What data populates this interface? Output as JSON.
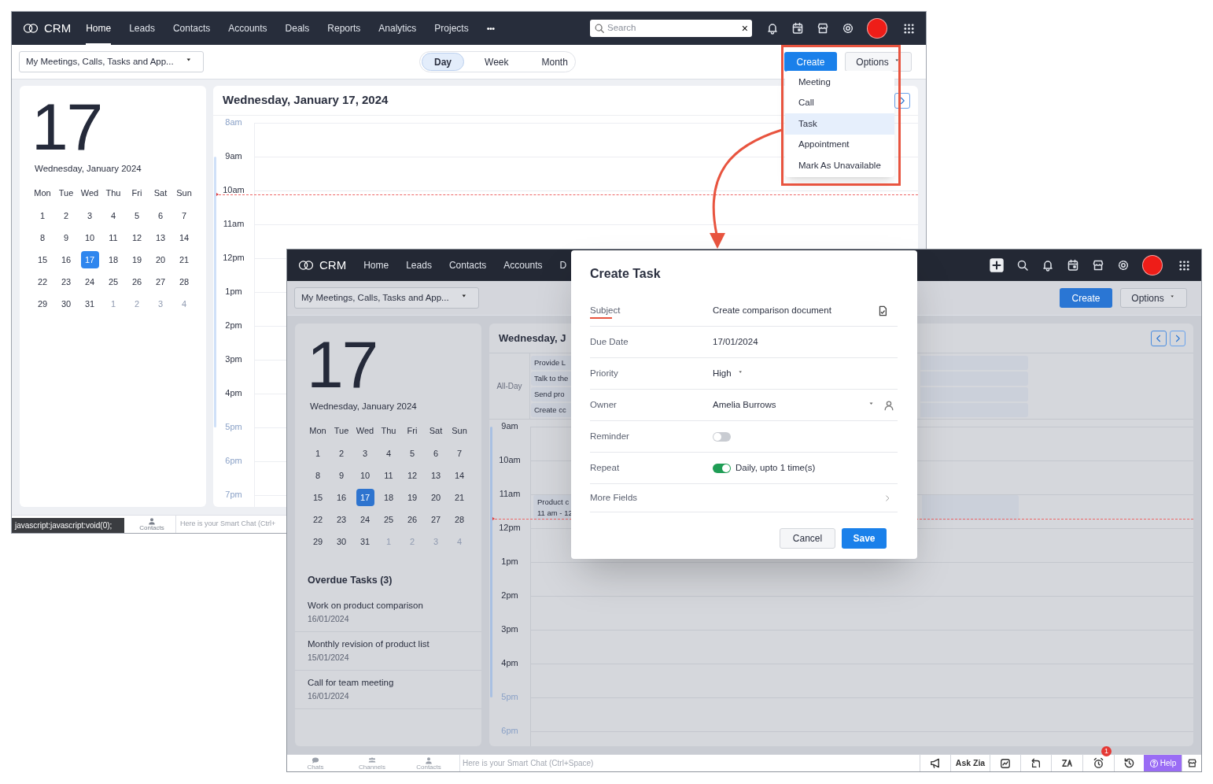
{
  "back_window": {
    "brand": "CRM",
    "nav": [
      {
        "label": "Home",
        "selected": true
      },
      {
        "label": "Leads",
        "selected": false
      },
      {
        "label": "Contacts",
        "selected": false
      },
      {
        "label": "Accounts",
        "selected": false
      },
      {
        "label": "Deals",
        "selected": false
      },
      {
        "label": "Reports",
        "selected": false
      },
      {
        "label": "Analytics",
        "selected": false
      },
      {
        "label": "Projects",
        "selected": false
      }
    ],
    "more": "•••",
    "search": {
      "placeholder": "Search",
      "clear": "×"
    },
    "filter": "My Meetings, Calls, Tasks and App...",
    "view_tabs": [
      {
        "label": "Day",
        "selected": true
      },
      {
        "label": "Week",
        "selected": false
      },
      {
        "label": "Month",
        "selected": false
      }
    ],
    "create": "Create",
    "options": "Options",
    "create_menu": [
      {
        "label": "Meeting",
        "selected": false
      },
      {
        "label": "Call",
        "selected": false
      },
      {
        "label": "Task",
        "selected": true
      },
      {
        "label": "Appointment",
        "selected": false
      },
      {
        "label": "Mark As Unavailable",
        "selected": false
      }
    ],
    "big_date": "17",
    "date_caption": "Wednesday, January 2024",
    "weekdays": [
      "Mon",
      "Tue",
      "Wed",
      "Thu",
      "Fri",
      "Sat",
      "Sun"
    ],
    "days": [
      {
        "label": "1",
        "other": false,
        "selected": false
      },
      {
        "label": "2",
        "other": false,
        "selected": false
      },
      {
        "label": "3",
        "other": false,
        "selected": false
      },
      {
        "label": "4",
        "other": false,
        "selected": false
      },
      {
        "label": "5",
        "other": false,
        "selected": false
      },
      {
        "label": "6",
        "other": false,
        "selected": false
      },
      {
        "label": "7",
        "other": false,
        "selected": false
      },
      {
        "label": "8",
        "other": false,
        "selected": false
      },
      {
        "label": "9",
        "other": false,
        "selected": false
      },
      {
        "label": "10",
        "other": false,
        "selected": false
      },
      {
        "label": "11",
        "other": false,
        "selected": false
      },
      {
        "label": "12",
        "other": false,
        "selected": false
      },
      {
        "label": "13",
        "other": false,
        "selected": false
      },
      {
        "label": "14",
        "other": false,
        "selected": false
      },
      {
        "label": "15",
        "other": false,
        "selected": false
      },
      {
        "label": "16",
        "other": false,
        "selected": false
      },
      {
        "label": "17",
        "other": false,
        "selected": true
      },
      {
        "label": "18",
        "other": false,
        "selected": false
      },
      {
        "label": "19",
        "other": false,
        "selected": false
      },
      {
        "label": "20",
        "other": false,
        "selected": false
      },
      {
        "label": "21",
        "other": false,
        "selected": false
      },
      {
        "label": "22",
        "other": false,
        "selected": false
      },
      {
        "label": "23",
        "other": false,
        "selected": false
      },
      {
        "label": "24",
        "other": false,
        "selected": false
      },
      {
        "label": "25",
        "other": false,
        "selected": false
      },
      {
        "label": "26",
        "other": false,
        "selected": false
      },
      {
        "label": "27",
        "other": false,
        "selected": false
      },
      {
        "label": "28",
        "other": false,
        "selected": false
      },
      {
        "label": "29",
        "other": false,
        "selected": false
      },
      {
        "label": "30",
        "other": false,
        "selected": false
      },
      {
        "label": "31",
        "other": false,
        "selected": false
      },
      {
        "label": "1",
        "other": true,
        "selected": false
      },
      {
        "label": "2",
        "other": true,
        "selected": false
      },
      {
        "label": "3",
        "other": true,
        "selected": false
      },
      {
        "label": "4",
        "other": true,
        "selected": false
      }
    ],
    "day_title": "Wednesday, January 17, 2024",
    "hours": [
      {
        "label": "8am",
        "working": false,
        "now": false
      },
      {
        "label": "9am",
        "working": true,
        "now": false
      },
      {
        "label": "10am",
        "working": true,
        "now": true
      },
      {
        "label": "11am",
        "working": true,
        "now": false
      },
      {
        "label": "12pm",
        "working": true,
        "now": false
      },
      {
        "label": "1pm",
        "working": true,
        "now": false
      },
      {
        "label": "2pm",
        "working": true,
        "now": false
      },
      {
        "label": "3pm",
        "working": true,
        "now": false
      },
      {
        "label": "4pm",
        "working": true,
        "now": false
      },
      {
        "label": "5pm",
        "working": false,
        "now": false
      },
      {
        "label": "6pm",
        "working": false,
        "now": false
      },
      {
        "label": "7pm",
        "working": false,
        "now": false
      }
    ],
    "status_tooltip": "javascript:javascript:void(0);",
    "chat_tabs": [
      "Contacts"
    ],
    "chat_hint": "Here is your Smart Chat (Ctrl+"
  },
  "front_window": {
    "brand": "CRM",
    "nav": [
      {
        "label": "Home",
        "selected": false
      },
      {
        "label": "Leads",
        "selected": false
      },
      {
        "label": "Contacts",
        "selected": false
      },
      {
        "label": "Accounts",
        "selected": false
      },
      {
        "label": "D",
        "selected": false
      }
    ],
    "filter": "My Meetings, Calls, Tasks and App...",
    "create": "Create",
    "options": "Options",
    "big_date": "17",
    "date_caption": "Wednesday, January 2024",
    "weekdays": [
      "Mon",
      "Tue",
      "Wed",
      "Thu",
      "Fri",
      "Sat",
      "Sun"
    ],
    "days": [
      {
        "label": "1",
        "other": false,
        "selected": false
      },
      {
        "label": "2",
        "other": false,
        "selected": false
      },
      {
        "label": "3",
        "other": false,
        "selected": false
      },
      {
        "label": "4",
        "other": false,
        "selected": false
      },
      {
        "label": "5",
        "other": false,
        "selected": false
      },
      {
        "label": "6",
        "other": false,
        "selected": false
      },
      {
        "label": "7",
        "other": false,
        "selected": false
      },
      {
        "label": "8",
        "other": false,
        "selected": false
      },
      {
        "label": "9",
        "other": false,
        "selected": false
      },
      {
        "label": "10",
        "other": false,
        "selected": false
      },
      {
        "label": "11",
        "other": false,
        "selected": false
      },
      {
        "label": "12",
        "other": false,
        "selected": false
      },
      {
        "label": "13",
        "other": false,
        "selected": false
      },
      {
        "label": "14",
        "other": false,
        "selected": false
      },
      {
        "label": "15",
        "other": false,
        "selected": false
      },
      {
        "label": "16",
        "other": false,
        "selected": false
      },
      {
        "label": "17",
        "other": false,
        "selected": true
      },
      {
        "label": "18",
        "other": false,
        "selected": false
      },
      {
        "label": "19",
        "other": false,
        "selected": false
      },
      {
        "label": "20",
        "other": false,
        "selected": false
      },
      {
        "label": "21",
        "other": false,
        "selected": false
      },
      {
        "label": "22",
        "other": false,
        "selected": false
      },
      {
        "label": "23",
        "other": false,
        "selected": false
      },
      {
        "label": "24",
        "other": false,
        "selected": false
      },
      {
        "label": "25",
        "other": false,
        "selected": false
      },
      {
        "label": "26",
        "other": false,
        "selected": false
      },
      {
        "label": "27",
        "other": false,
        "selected": false
      },
      {
        "label": "28",
        "other": false,
        "selected": false
      },
      {
        "label": "29",
        "other": false,
        "selected": false
      },
      {
        "label": "30",
        "other": false,
        "selected": false
      },
      {
        "label": "31",
        "other": false,
        "selected": false
      },
      {
        "label": "1",
        "other": true,
        "selected": false
      },
      {
        "label": "2",
        "other": true,
        "selected": false
      },
      {
        "label": "3",
        "other": true,
        "selected": false
      },
      {
        "label": "4",
        "other": true,
        "selected": false
      }
    ],
    "overdue_title": "Overdue Tasks (3)",
    "overdue": [
      {
        "title": "Work on product comparison",
        "date": "16/01/2024"
      },
      {
        "title": "Monthly revision of product list",
        "date": "15/01/2024"
      },
      {
        "title": "Call for team meeting",
        "date": "16/01/2024"
      }
    ],
    "day_title": "Wednesday, J",
    "all_day_label": "All-Day",
    "all_day_events": [
      "Provide L",
      "Talk to the",
      "Send pro",
      "Create cc"
    ],
    "hours": [
      {
        "label": "9am",
        "working": true,
        "now": false
      },
      {
        "label": "10am",
        "working": true,
        "now": false
      },
      {
        "label": "11am",
        "working": true,
        "now": true
      },
      {
        "label": "12pm",
        "working": true,
        "now": false
      },
      {
        "label": "1pm",
        "working": true,
        "now": false
      },
      {
        "label": "2pm",
        "working": true,
        "now": false
      },
      {
        "label": "3pm",
        "working": true,
        "now": false
      },
      {
        "label": "4pm",
        "working": true,
        "now": false
      },
      {
        "label": "5pm",
        "working": false,
        "now": false
      },
      {
        "label": "6pm",
        "working": false,
        "now": false
      }
    ],
    "event": {
      "title": "Product c",
      "time": "11 am - 12"
    },
    "chat_tabs": [
      "Chats",
      "Channels",
      "Contacts"
    ],
    "chat_hint": "Here is your Smart Chat (Ctrl+Space)",
    "ask_zia": "Ask Zia",
    "alarm_badge": "1",
    "help": "Help"
  },
  "dialog": {
    "title": "Create Task",
    "fields": [
      {
        "kind": "text",
        "label": "Subject",
        "value": "Create comparison document",
        "focused": true
      },
      {
        "kind": "date",
        "label": "Due Date",
        "value": "17/01/2024",
        "focused": false
      },
      {
        "kind": "select",
        "label": "Priority",
        "value": "High",
        "focused": false
      },
      {
        "kind": "lookup",
        "label": "Owner",
        "value": "Amelia Burrows",
        "focused": false
      },
      {
        "kind": "toggle",
        "label": "Reminder",
        "on": false,
        "focused": false
      },
      {
        "kind": "toggle",
        "label": "Repeat",
        "on": true,
        "value": "Daily, upto 1 time(s)",
        "focused": false
      },
      {
        "kind": "link",
        "label": "More Fields",
        "focused": false
      }
    ],
    "cancel": "Cancel",
    "save": "Save"
  }
}
